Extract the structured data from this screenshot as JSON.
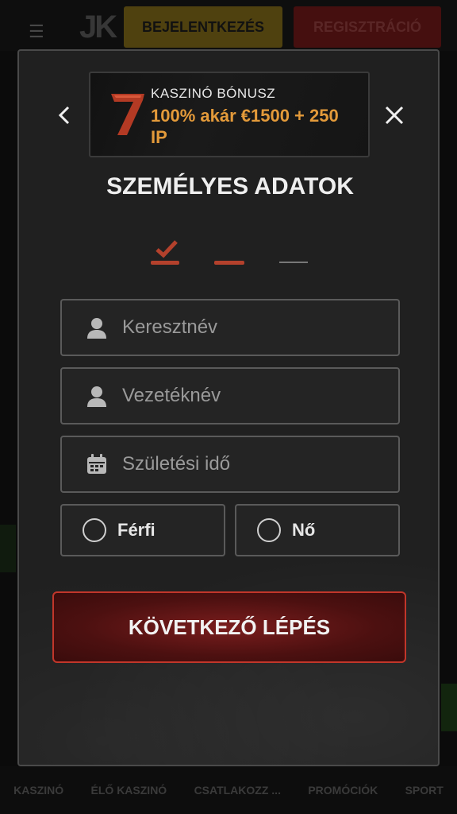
{
  "background": {
    "login_label": "BEJELENTKEZÉS",
    "register_label": "REGISZTRÁCIÓ",
    "logo_text": "JK",
    "bottom_nav": [
      "KASZINÓ",
      "ÉLŐ KASZINÓ",
      "CSATLAKOZZ ...",
      "PROMÓCIÓK",
      "SPORT"
    ]
  },
  "bonus": {
    "title": "KASZINÓ BÓNUSZ",
    "offer": "100% akár €1500 + 250 IP"
  },
  "form": {
    "heading": "SZEMÉLYES ADATOK",
    "first_name_placeholder": "Keresztnév",
    "last_name_placeholder": "Vezetéknév",
    "birthdate_placeholder": "Születési idő",
    "gender_male": "Férfi",
    "gender_female": "Nő",
    "next_button": "KÖVETKEZŐ LÉPÉS"
  },
  "icons": {
    "menu": "menu-search-icon",
    "back": "chevron-left-icon",
    "close": "close-icon",
    "seven": "seven-logo-icon",
    "user": "user-icon",
    "calendar": "calendar-icon",
    "checkmark": "checkmark-icon"
  },
  "colors": {
    "accent_red": "#b4412c",
    "bonus_orange": "#e39a3a",
    "button_border": "#c2362a"
  },
  "steps": {
    "current": 2,
    "total": 3
  }
}
